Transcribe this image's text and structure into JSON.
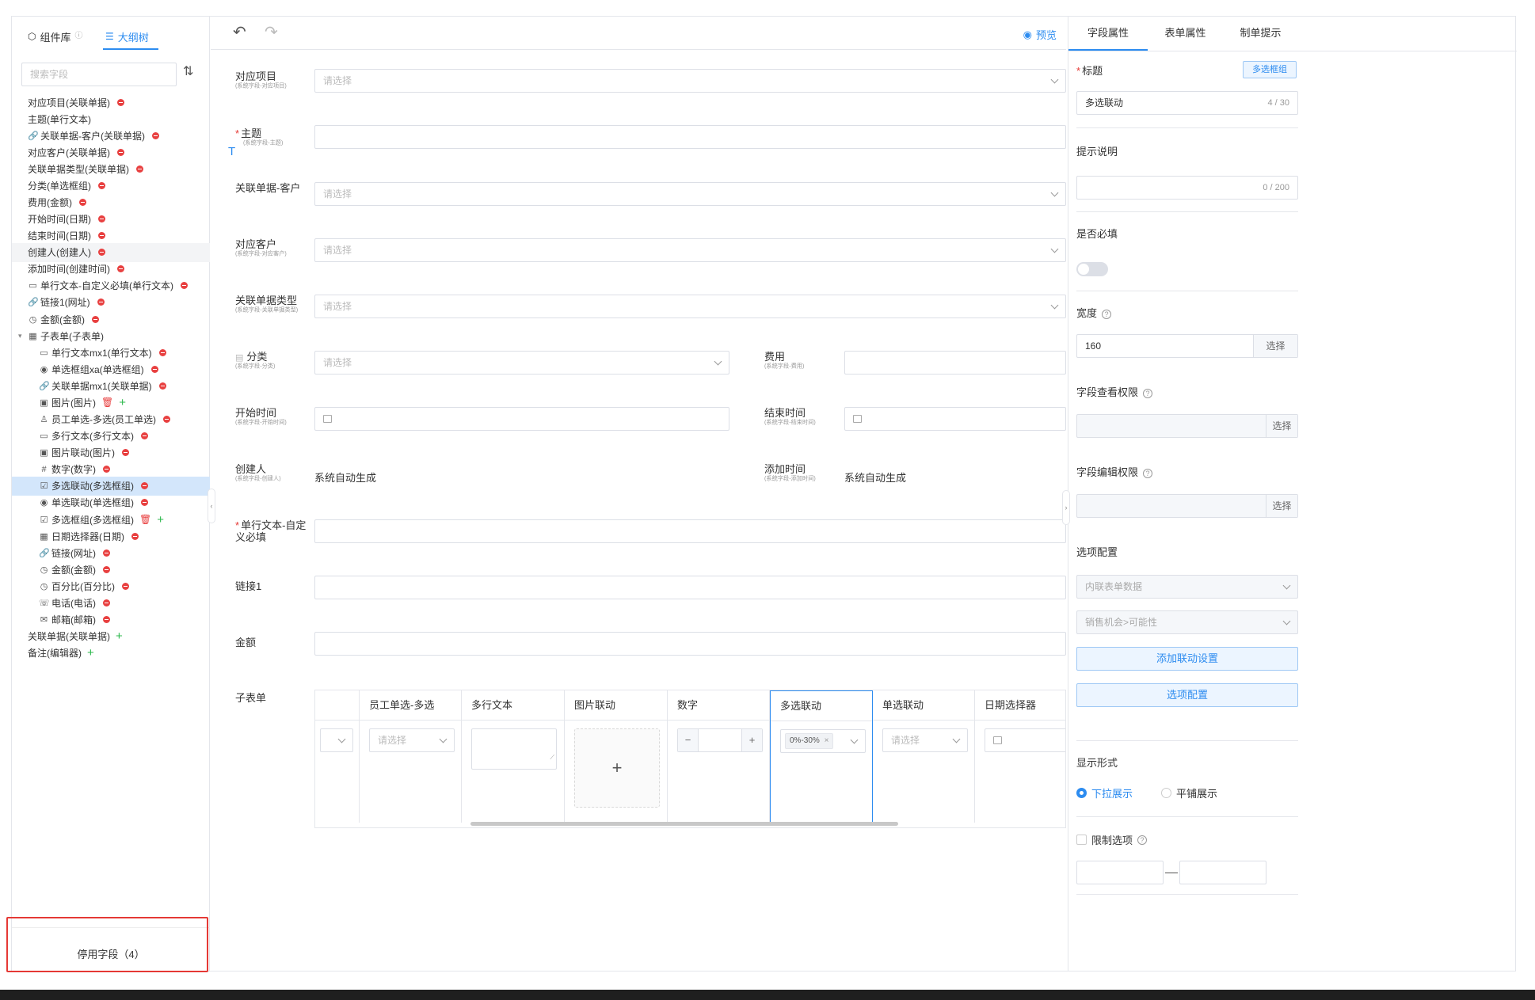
{
  "left": {
    "tabs": {
      "components": "组件库",
      "outline": "大纲树"
    },
    "search_placeholder": "搜索字段",
    "disabled_fields": "停用字段（4）",
    "items": [
      {
        "label": "对应项目(关联单据)"
      },
      {
        "label": "主题(单行文本)"
      },
      {
        "label": "关联单据-客户(关联单据)"
      },
      {
        "label": "对应客户(关联单据)"
      },
      {
        "label": "关联单据类型(关联单据)"
      },
      {
        "label": "分类(单选框组)"
      },
      {
        "label": "费用(金额)"
      },
      {
        "label": "开始时间(日期)"
      },
      {
        "label": "结束时间(日期)"
      },
      {
        "label": "创建人(创建人)"
      },
      {
        "label": "添加时间(创建时间)"
      },
      {
        "label": "单行文本-自定义必填(单行文本)"
      },
      {
        "label": "链接1(网址)"
      },
      {
        "label": "金额(金额)"
      },
      {
        "label": "子表单(子表单)"
      },
      {
        "label": "单行文本mx1(单行文本)"
      },
      {
        "label": "单选框组xa(单选框组)"
      },
      {
        "label": "关联单据mx1(关联单据)"
      },
      {
        "label": "图片(图片)"
      },
      {
        "label": "员工单选-多选(员工单选)"
      },
      {
        "label": "多行文本(多行文本)"
      },
      {
        "label": "图片联动(图片)"
      },
      {
        "label": "数字(数字)"
      },
      {
        "label": "多选联动(多选框组)"
      },
      {
        "label": "单选联动(单选框组)"
      },
      {
        "label": "多选框组(多选框组)"
      },
      {
        "label": "日期选择器(日期)"
      },
      {
        "label": "链接(网址)"
      },
      {
        "label": "金额(金额)"
      },
      {
        "label": "百分比(百分比)"
      },
      {
        "label": "电话(电话)"
      },
      {
        "label": "邮箱(邮箱)"
      },
      {
        "label": "关联单据(关联单据)"
      },
      {
        "label": "备注(编辑器)"
      }
    ]
  },
  "toolbar": {
    "preview": "预览"
  },
  "form": {
    "placeholder": "请选择",
    "project": {
      "label": "对应项目",
      "sub": "(系统字段-对应项目)"
    },
    "subject": {
      "label": "主题",
      "sub": "(系统字段-主题)"
    },
    "rel_customer": {
      "label": "关联单据-客户"
    },
    "customer": {
      "label": "对应客户",
      "sub": "(系统字段-对应客户)"
    },
    "rel_type": {
      "label": "关联单据类型",
      "sub": "(系统字段-关联单据类型)"
    },
    "category": {
      "label": "分类",
      "sub": "(系统字段-分类)"
    },
    "cost": {
      "label": "费用",
      "sub": "(系统字段-费用)"
    },
    "start": {
      "label": "开始时间",
      "sub": "(系统字段-开始时间)"
    },
    "end": {
      "label": "结束时间",
      "sub": "(系统字段-结束时间)"
    },
    "creator": {
      "label": "创建人",
      "sub": "(系统字段-创建人)",
      "value": "系统自动生成"
    },
    "added": {
      "label": "添加时间",
      "sub": "(系统字段-添加时间)",
      "value": "系统自动生成"
    },
    "custom_text": {
      "label": "单行文本-自定义必填"
    },
    "link1": {
      "label": "链接1"
    },
    "amount": {
      "label": "金额"
    },
    "subform": {
      "label": "子表单",
      "columns": [
        "员工单选-多选",
        "多行文本",
        "图片联动",
        "数字",
        "多选联动",
        "单选联动",
        "日期选择器"
      ],
      "multi_tag": "0%-30%"
    }
  },
  "right": {
    "tabs": [
      "字段属性",
      "表单属性",
      "制单提示"
    ],
    "title_label": "标题",
    "type_badge": "多选框组",
    "title_value": "多选联动",
    "title_count": "4 / 30",
    "hint_label": "提示说明",
    "hint_count": "0 / 200",
    "required_label": "是否必填",
    "width_label": "宽度",
    "width_value": "160",
    "select": "选择",
    "view_perm": "字段查看权限",
    "edit_perm": "字段编辑权限",
    "options_config": "选项配置",
    "source_value": "内联表单数据",
    "source2_value": "销售机会>可能性",
    "add_linkage": "添加联动设置",
    "options_btn": "选项配置",
    "display_label": "显示形式",
    "display_dropdown": "下拉展示",
    "display_flat": "平铺展示",
    "limit_label": "限制选项",
    "colors": {
      "accent": "#2d8cf0",
      "danger": "#e53935"
    }
  }
}
